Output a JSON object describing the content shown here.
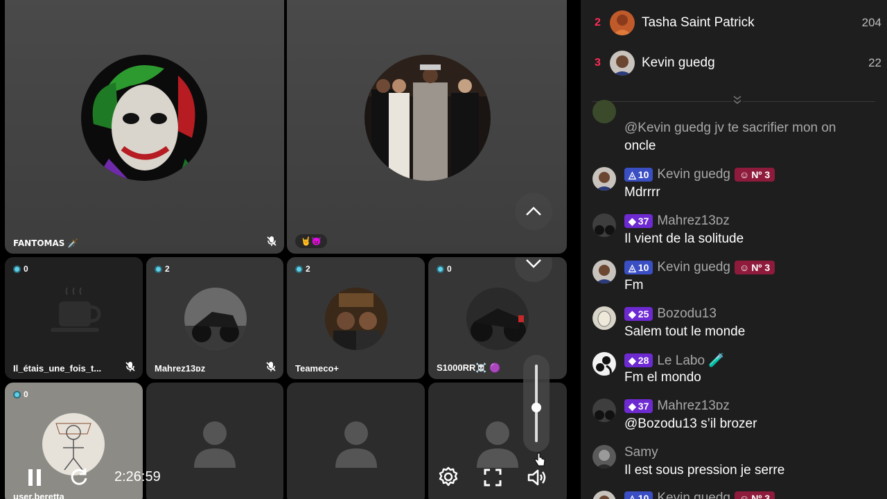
{
  "stage": {
    "host_tiles": [
      {
        "name": "FANTOMAS 🗡️",
        "muted": true
      },
      {
        "badge": "🤘😈",
        "muted": false
      }
    ],
    "guest_tiles": [
      {
        "name": "Il_étais_une_fois_t...",
        "gifts": "0",
        "muted": true,
        "avatar": "coffee-placeholder"
      },
      {
        "name": "Mahrez13ᴅᴢ",
        "gifts": "2",
        "muted": true,
        "avatar": "motorcycle"
      },
      {
        "name": "Teameco+",
        "gifts": "2",
        "muted": false,
        "avatar": "two-men-studio"
      },
      {
        "name": "S1000RR☠️ 🟣",
        "gifts": "0",
        "muted": false,
        "avatar": "bike-night"
      },
      {
        "name": "user.beretta",
        "gifts": "0",
        "muted": false,
        "avatar": "drawing"
      }
    ],
    "empty_slots": 3,
    "volume_level": 0.45,
    "timer": "2:26:59"
  },
  "ranking": [
    {
      "rank": "2",
      "name": "Tasha Saint Patrick",
      "score": "204"
    },
    {
      "rank": "3",
      "name": "Kevin guedg",
      "score": "22"
    }
  ],
  "chat": {
    "messages": [
      {
        "user": "",
        "text_line1": "@Kevin guedg jv te sacrifier mon on",
        "text_line2": "oncle"
      },
      {
        "user": "Kevin guedg",
        "level": "10",
        "level_color": "blue",
        "rank_badge": "Nº 3",
        "text": "Mdrrrr"
      },
      {
        "user": "Mahrez13ᴅᴢ",
        "level": "37",
        "level_color": "purple",
        "text": "Il vient de la solitude"
      },
      {
        "user": "Kevin guedg",
        "level": "10",
        "level_color": "blue",
        "rank_badge": "Nº 3",
        "text": "Fm"
      },
      {
        "user": "Bozodu13",
        "level": "25",
        "level_color": "purple",
        "text": "Salem tout le monde"
      },
      {
        "user": "Le Labo 🧪",
        "level": "28",
        "level_color": "purple",
        "text": "Fm el mondo"
      },
      {
        "user": "Mahrez13ᴅᴢ",
        "level": "37",
        "level_color": "purple",
        "text": "@Bozodu13 s’il brozer"
      },
      {
        "user": "Samy",
        "text": "Il est sous pression je serre"
      },
      {
        "user": "Kevin guedg",
        "level": "10",
        "level_color": "blue",
        "rank_badge": "Nº 3",
        "text": ""
      }
    ]
  },
  "colors": {
    "rank_red": "#fe2c55",
    "level_blue": "#3b4fc4",
    "level_purple": "#6e2ad1",
    "rank_badge": "#8e1b3c"
  },
  "icons": [
    "mic-off-icon",
    "gift-icon",
    "chevron-up-icon",
    "chevron-down-icon",
    "pause-icon",
    "refresh-icon",
    "settings-icon",
    "fullscreen-icon",
    "speaker-icon",
    "double-chevron-down-icon",
    "diamond-icon",
    "medal-icon",
    "person-placeholder-icon"
  ]
}
